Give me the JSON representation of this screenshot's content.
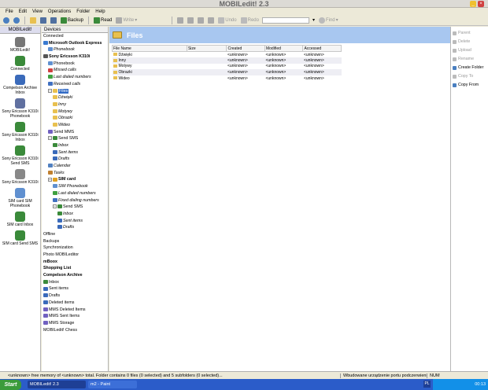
{
  "window": {
    "title": "MOBILedit! 2.3"
  },
  "menu": [
    "File",
    "Edit",
    "View",
    "Operations",
    "Folder",
    "Help"
  ],
  "toolbar": {
    "backup": "Backup",
    "read": "Read",
    "write": "Write",
    "undo": "Undo",
    "redo": "Redo",
    "find": "Find"
  },
  "left_bar": {
    "header": "MOBILedit!",
    "items": [
      {
        "label": "MOBILedit!",
        "icon": "mobiledit-icon"
      },
      {
        "label": "Connected",
        "icon": "connected-icon"
      },
      {
        "label": "Compelson Archive Inbox",
        "icon": "archive-icon"
      },
      {
        "label": "Sony Ericsson K310i Phonebook",
        "icon": "phonebook-icon"
      },
      {
        "label": "Sony Ericsson K310i Inbox",
        "icon": "inbox-icon"
      },
      {
        "label": "Sony Ericsson K310i Send SMS",
        "icon": "send-sms-icon"
      },
      {
        "label": "Sony Ericsson K310i",
        "icon": "phone-icon"
      },
      {
        "label": "SIM card SIM Phonebook",
        "icon": "sim-phonebook-icon"
      },
      {
        "label": "SIM card Inbox",
        "icon": "sim-inbox-icon"
      },
      {
        "label": "SIM card Send SMS",
        "icon": "sim-send-icon"
      }
    ]
  },
  "tree": {
    "header": "Devices",
    "nodes": [
      {
        "label": "Connected",
        "indent": 0,
        "style": ""
      },
      {
        "label": "Microsoft Outlook Express",
        "indent": 0,
        "style": "b",
        "color": "#3a7ad0"
      },
      {
        "label": "Phonebook",
        "indent": 1,
        "style": "i",
        "color": "#6090d0"
      },
      {
        "label": "Sony Ericsson K310i",
        "indent": 0,
        "style": "b",
        "color": "#555"
      },
      {
        "label": "Phonebook",
        "indent": 1,
        "style": "",
        "color": "#6090d0"
      },
      {
        "label": "Missed calls",
        "indent": 1,
        "style": "i",
        "color": "#d04040"
      },
      {
        "label": "Last dialed numbers",
        "indent": 1,
        "style": "i",
        "color": "#40a040"
      },
      {
        "label": "Received calls",
        "indent": 1,
        "style": "i",
        "color": "#4070c0"
      },
      {
        "label": "Files",
        "indent": 1,
        "style": "",
        "color": "#e8c050",
        "exp": "−",
        "sel": true
      },
      {
        "label": "Dźwięki",
        "indent": 2,
        "style": "i",
        "color": "#e8c050"
      },
      {
        "label": "Inny",
        "indent": 2,
        "style": "i",
        "color": "#e8c050"
      },
      {
        "label": "Motywy",
        "indent": 2,
        "style": "i",
        "color": "#e8c050"
      },
      {
        "label": "Obrazki",
        "indent": 2,
        "style": "i",
        "color": "#e8c050"
      },
      {
        "label": "Wideo",
        "indent": 2,
        "style": "i",
        "color": "#e8c050"
      },
      {
        "label": "Send MMS",
        "indent": 1,
        "style": "",
        "color": "#7060c0"
      },
      {
        "label": "Send SMS",
        "indent": 1,
        "style": "",
        "color": "#3a8a3a",
        "exp": "−"
      },
      {
        "label": "Inbox",
        "indent": 2,
        "style": "i",
        "color": "#3a8a3a"
      },
      {
        "label": "Sent items",
        "indent": 2,
        "style": "i",
        "color": "#3a6aba"
      },
      {
        "label": "Drafts",
        "indent": 2,
        "style": "i",
        "color": "#3a6aba"
      },
      {
        "label": "Calendar",
        "indent": 1,
        "style": "i",
        "color": "#5080c0"
      },
      {
        "label": "Tasks",
        "indent": 1,
        "style": "i",
        "color": "#c08030"
      },
      {
        "label": "SIM card",
        "indent": 1,
        "style": "b",
        "color": "#e0a020",
        "exp": "−"
      },
      {
        "label": "SIM Phonebook",
        "indent": 2,
        "style": "i",
        "color": "#6090d0"
      },
      {
        "label": "Last dialed numbers",
        "indent": 2,
        "style": "i",
        "color": "#40a040"
      },
      {
        "label": "Fixed dialing numbers",
        "indent": 2,
        "style": "i",
        "color": "#4070c0"
      },
      {
        "label": "Send SMS",
        "indent": 2,
        "style": "",
        "color": "#3a8a3a",
        "exp": "−"
      },
      {
        "label": "Inbox",
        "indent": 3,
        "style": "i",
        "color": "#3a8a3a"
      },
      {
        "label": "Sent items",
        "indent": 3,
        "style": "i",
        "color": "#3a6aba"
      },
      {
        "label": "Drafts",
        "indent": 3,
        "style": "i",
        "color": "#3a6aba"
      },
      {
        "label": "Offline",
        "indent": 0,
        "style": ""
      },
      {
        "label": "Backups",
        "indent": 0,
        "style": ""
      },
      {
        "label": "Synchronization",
        "indent": 0,
        "style": ""
      },
      {
        "label": "Photo MOBILeditor",
        "indent": 0,
        "style": ""
      },
      {
        "label": "mBoox",
        "indent": 0,
        "style": "b"
      },
      {
        "label": "Shopping List",
        "indent": 0,
        "style": "b"
      },
      {
        "label": "Compelson Archive",
        "indent": 0,
        "style": "b"
      },
      {
        "label": "Inbox",
        "indent": 0,
        "style": "",
        "color": "#3a8a3a"
      },
      {
        "label": "Sent items",
        "indent": 0,
        "style": "",
        "color": "#3a6aba"
      },
      {
        "label": "Drafts",
        "indent": 0,
        "style": "",
        "color": "#3a6aba"
      },
      {
        "label": "Deleted items",
        "indent": 0,
        "style": "",
        "color": "#3a6aba"
      },
      {
        "label": "MMS Deleted Items",
        "indent": 0,
        "style": "",
        "color": "#7060c0"
      },
      {
        "label": "MMS Sent Items",
        "indent": 0,
        "style": "",
        "color": "#7060c0"
      },
      {
        "label": "MMS Storage",
        "indent": 0,
        "style": "",
        "color": "#7060c0"
      },
      {
        "label": "MOBILedit! Chess",
        "indent": 0,
        "style": ""
      }
    ]
  },
  "main": {
    "title": "Files",
    "columns": [
      "File Name",
      "Size",
      "Created",
      "Modified",
      "Accessed"
    ],
    "rows": [
      [
        "Dźwięki",
        "",
        "<unknown>",
        "<unknown>",
        "<unknown>"
      ],
      [
        "Inny",
        "",
        "<unknown>",
        "<unknown>",
        "<unknown>"
      ],
      [
        "Motywy",
        "",
        "<unknown>",
        "<unknown>",
        "<unknown>"
      ],
      [
        "Obrazki",
        "",
        "<unknown>",
        "<unknown>",
        "<unknown>"
      ],
      [
        "Wideo",
        "",
        "<unknown>",
        "<unknown>",
        "<unknown>"
      ]
    ]
  },
  "actions": [
    {
      "label": "Parent",
      "enabled": false
    },
    {
      "label": "Delete",
      "enabled": false
    },
    {
      "label": "Upload",
      "enabled": false
    },
    {
      "label": "Rename",
      "enabled": false
    },
    {
      "label": "Create Folder",
      "enabled": true
    },
    {
      "label": "Copy To",
      "enabled": false
    },
    {
      "label": "Copy From",
      "enabled": true
    }
  ],
  "status": {
    "message": "<unknown> free memory of <unknown> total. Folder contains 0 files (0 selected) and 5 subfolders (0 selected)...",
    "port": "Wbudowane urządzenie portu podczerwieni",
    "num": "NUM"
  },
  "taskbar": {
    "start": "Start",
    "tasks": [
      "MOBILedit! 2.3",
      "m2 - Paint"
    ],
    "lang": "PL",
    "clock": "00:13"
  }
}
